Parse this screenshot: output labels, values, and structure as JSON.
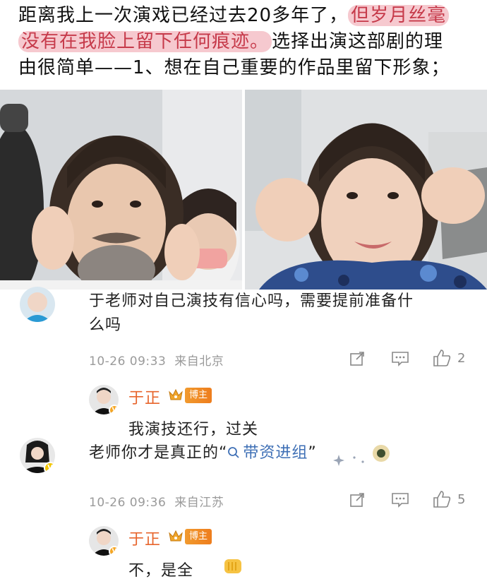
{
  "post": {
    "line1_a": "距离我上一次演戏已经过去",
    "line1_num": "20",
    "line1_b": "多年了，",
    "highlight_1": "但岁月丝毫",
    "highlight_2": "没有在我脸上留下任何痕迹。",
    "line2_rest": "选择出演这部剧的理",
    "line3": "由很简单——1、想在自己重要的作品里留下形象；"
  },
  "comments": [
    {
      "text_line1": "于老师对自己演技有信心吗，需要提前准备什",
      "text_line2": "么吗",
      "time": "10-26 09:33",
      "location": "来自北京",
      "likes": "2",
      "reply": {
        "author": "于正",
        "badge": "博主",
        "text": "我演技还行，过关"
      }
    },
    {
      "text_prefix": "老师你才是真正的“",
      "link": "带资进组",
      "text_suffix": "”",
      "time": "10-26 09:36",
      "location": "来自江苏",
      "likes": "5",
      "reply": {
        "author": "于正",
        "badge": "博主",
        "text": "不，是全"
      }
    }
  ],
  "colors": {
    "highlight_bg": "#f6c9cf",
    "highlight_text": "#c63a4a",
    "author": "#e7652c",
    "link": "#3e6fb5",
    "meta": "#9a9a9a"
  }
}
